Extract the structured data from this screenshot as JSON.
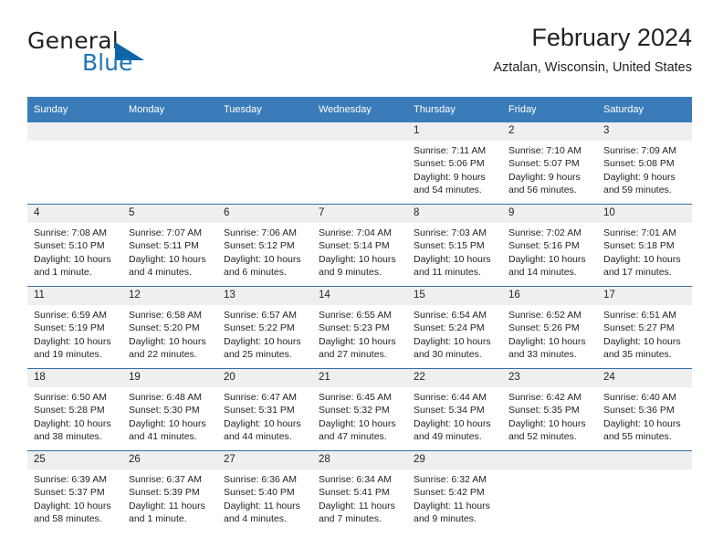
{
  "brand": {
    "name_part1": "General",
    "name_part2": "Blue",
    "logo_icon": "triangle-logo-icon"
  },
  "header": {
    "title": "February 2024",
    "location": "Aztalan, Wisconsin, United States"
  },
  "calendar": {
    "weekday_headers": [
      "Sunday",
      "Monday",
      "Tuesday",
      "Wednesday",
      "Thursday",
      "Friday",
      "Saturday"
    ],
    "colors": {
      "header_bg": "#3a7cb9",
      "row_border": "#2f6fa8",
      "daynum_bg": "#efefef",
      "brand_blue": "#1e74bb",
      "text": "#231f20"
    },
    "weeks": [
      [
        {
          "day": "",
          "lines": []
        },
        {
          "day": "",
          "lines": []
        },
        {
          "day": "",
          "lines": []
        },
        {
          "day": "",
          "lines": []
        },
        {
          "day": "1",
          "lines": [
            "Sunrise: 7:11 AM",
            "Sunset: 5:06 PM",
            "Daylight: 9 hours",
            "and 54 minutes."
          ]
        },
        {
          "day": "2",
          "lines": [
            "Sunrise: 7:10 AM",
            "Sunset: 5:07 PM",
            "Daylight: 9 hours",
            "and 56 minutes."
          ]
        },
        {
          "day": "3",
          "lines": [
            "Sunrise: 7:09 AM",
            "Sunset: 5:08 PM",
            "Daylight: 9 hours",
            "and 59 minutes."
          ]
        }
      ],
      [
        {
          "day": "4",
          "lines": [
            "Sunrise: 7:08 AM",
            "Sunset: 5:10 PM",
            "Daylight: 10 hours",
            "and 1 minute."
          ]
        },
        {
          "day": "5",
          "lines": [
            "Sunrise: 7:07 AM",
            "Sunset: 5:11 PM",
            "Daylight: 10 hours",
            "and 4 minutes."
          ]
        },
        {
          "day": "6",
          "lines": [
            "Sunrise: 7:06 AM",
            "Sunset: 5:12 PM",
            "Daylight: 10 hours",
            "and 6 minutes."
          ]
        },
        {
          "day": "7",
          "lines": [
            "Sunrise: 7:04 AM",
            "Sunset: 5:14 PM",
            "Daylight: 10 hours",
            "and 9 minutes."
          ]
        },
        {
          "day": "8",
          "lines": [
            "Sunrise: 7:03 AM",
            "Sunset: 5:15 PM",
            "Daylight: 10 hours",
            "and 11 minutes."
          ]
        },
        {
          "day": "9",
          "lines": [
            "Sunrise: 7:02 AM",
            "Sunset: 5:16 PM",
            "Daylight: 10 hours",
            "and 14 minutes."
          ]
        },
        {
          "day": "10",
          "lines": [
            "Sunrise: 7:01 AM",
            "Sunset: 5:18 PM",
            "Daylight: 10 hours",
            "and 17 minutes."
          ]
        }
      ],
      [
        {
          "day": "11",
          "lines": [
            "Sunrise: 6:59 AM",
            "Sunset: 5:19 PM",
            "Daylight: 10 hours",
            "and 19 minutes."
          ]
        },
        {
          "day": "12",
          "lines": [
            "Sunrise: 6:58 AM",
            "Sunset: 5:20 PM",
            "Daylight: 10 hours",
            "and 22 minutes."
          ]
        },
        {
          "day": "13",
          "lines": [
            "Sunrise: 6:57 AM",
            "Sunset: 5:22 PM",
            "Daylight: 10 hours",
            "and 25 minutes."
          ]
        },
        {
          "day": "14",
          "lines": [
            "Sunrise: 6:55 AM",
            "Sunset: 5:23 PM",
            "Daylight: 10 hours",
            "and 27 minutes."
          ]
        },
        {
          "day": "15",
          "lines": [
            "Sunrise: 6:54 AM",
            "Sunset: 5:24 PM",
            "Daylight: 10 hours",
            "and 30 minutes."
          ]
        },
        {
          "day": "16",
          "lines": [
            "Sunrise: 6:52 AM",
            "Sunset: 5:26 PM",
            "Daylight: 10 hours",
            "and 33 minutes."
          ]
        },
        {
          "day": "17",
          "lines": [
            "Sunrise: 6:51 AM",
            "Sunset: 5:27 PM",
            "Daylight: 10 hours",
            "and 35 minutes."
          ]
        }
      ],
      [
        {
          "day": "18",
          "lines": [
            "Sunrise: 6:50 AM",
            "Sunset: 5:28 PM",
            "Daylight: 10 hours",
            "and 38 minutes."
          ]
        },
        {
          "day": "19",
          "lines": [
            "Sunrise: 6:48 AM",
            "Sunset: 5:30 PM",
            "Daylight: 10 hours",
            "and 41 minutes."
          ]
        },
        {
          "day": "20",
          "lines": [
            "Sunrise: 6:47 AM",
            "Sunset: 5:31 PM",
            "Daylight: 10 hours",
            "and 44 minutes."
          ]
        },
        {
          "day": "21",
          "lines": [
            "Sunrise: 6:45 AM",
            "Sunset: 5:32 PM",
            "Daylight: 10 hours",
            "and 47 minutes."
          ]
        },
        {
          "day": "22",
          "lines": [
            "Sunrise: 6:44 AM",
            "Sunset: 5:34 PM",
            "Daylight: 10 hours",
            "and 49 minutes."
          ]
        },
        {
          "day": "23",
          "lines": [
            "Sunrise: 6:42 AM",
            "Sunset: 5:35 PM",
            "Daylight: 10 hours",
            "and 52 minutes."
          ]
        },
        {
          "day": "24",
          "lines": [
            "Sunrise: 6:40 AM",
            "Sunset: 5:36 PM",
            "Daylight: 10 hours",
            "and 55 minutes."
          ]
        }
      ],
      [
        {
          "day": "25",
          "lines": [
            "Sunrise: 6:39 AM",
            "Sunset: 5:37 PM",
            "Daylight: 10 hours",
            "and 58 minutes."
          ]
        },
        {
          "day": "26",
          "lines": [
            "Sunrise: 6:37 AM",
            "Sunset: 5:39 PM",
            "Daylight: 11 hours",
            "and 1 minute."
          ]
        },
        {
          "day": "27",
          "lines": [
            "Sunrise: 6:36 AM",
            "Sunset: 5:40 PM",
            "Daylight: 11 hours",
            "and 4 minutes."
          ]
        },
        {
          "day": "28",
          "lines": [
            "Sunrise: 6:34 AM",
            "Sunset: 5:41 PM",
            "Daylight: 11 hours",
            "and 7 minutes."
          ]
        },
        {
          "day": "29",
          "lines": [
            "Sunrise: 6:32 AM",
            "Sunset: 5:42 PM",
            "Daylight: 11 hours",
            "and 9 minutes."
          ]
        },
        {
          "day": "",
          "lines": []
        },
        {
          "day": "",
          "lines": []
        }
      ]
    ]
  }
}
